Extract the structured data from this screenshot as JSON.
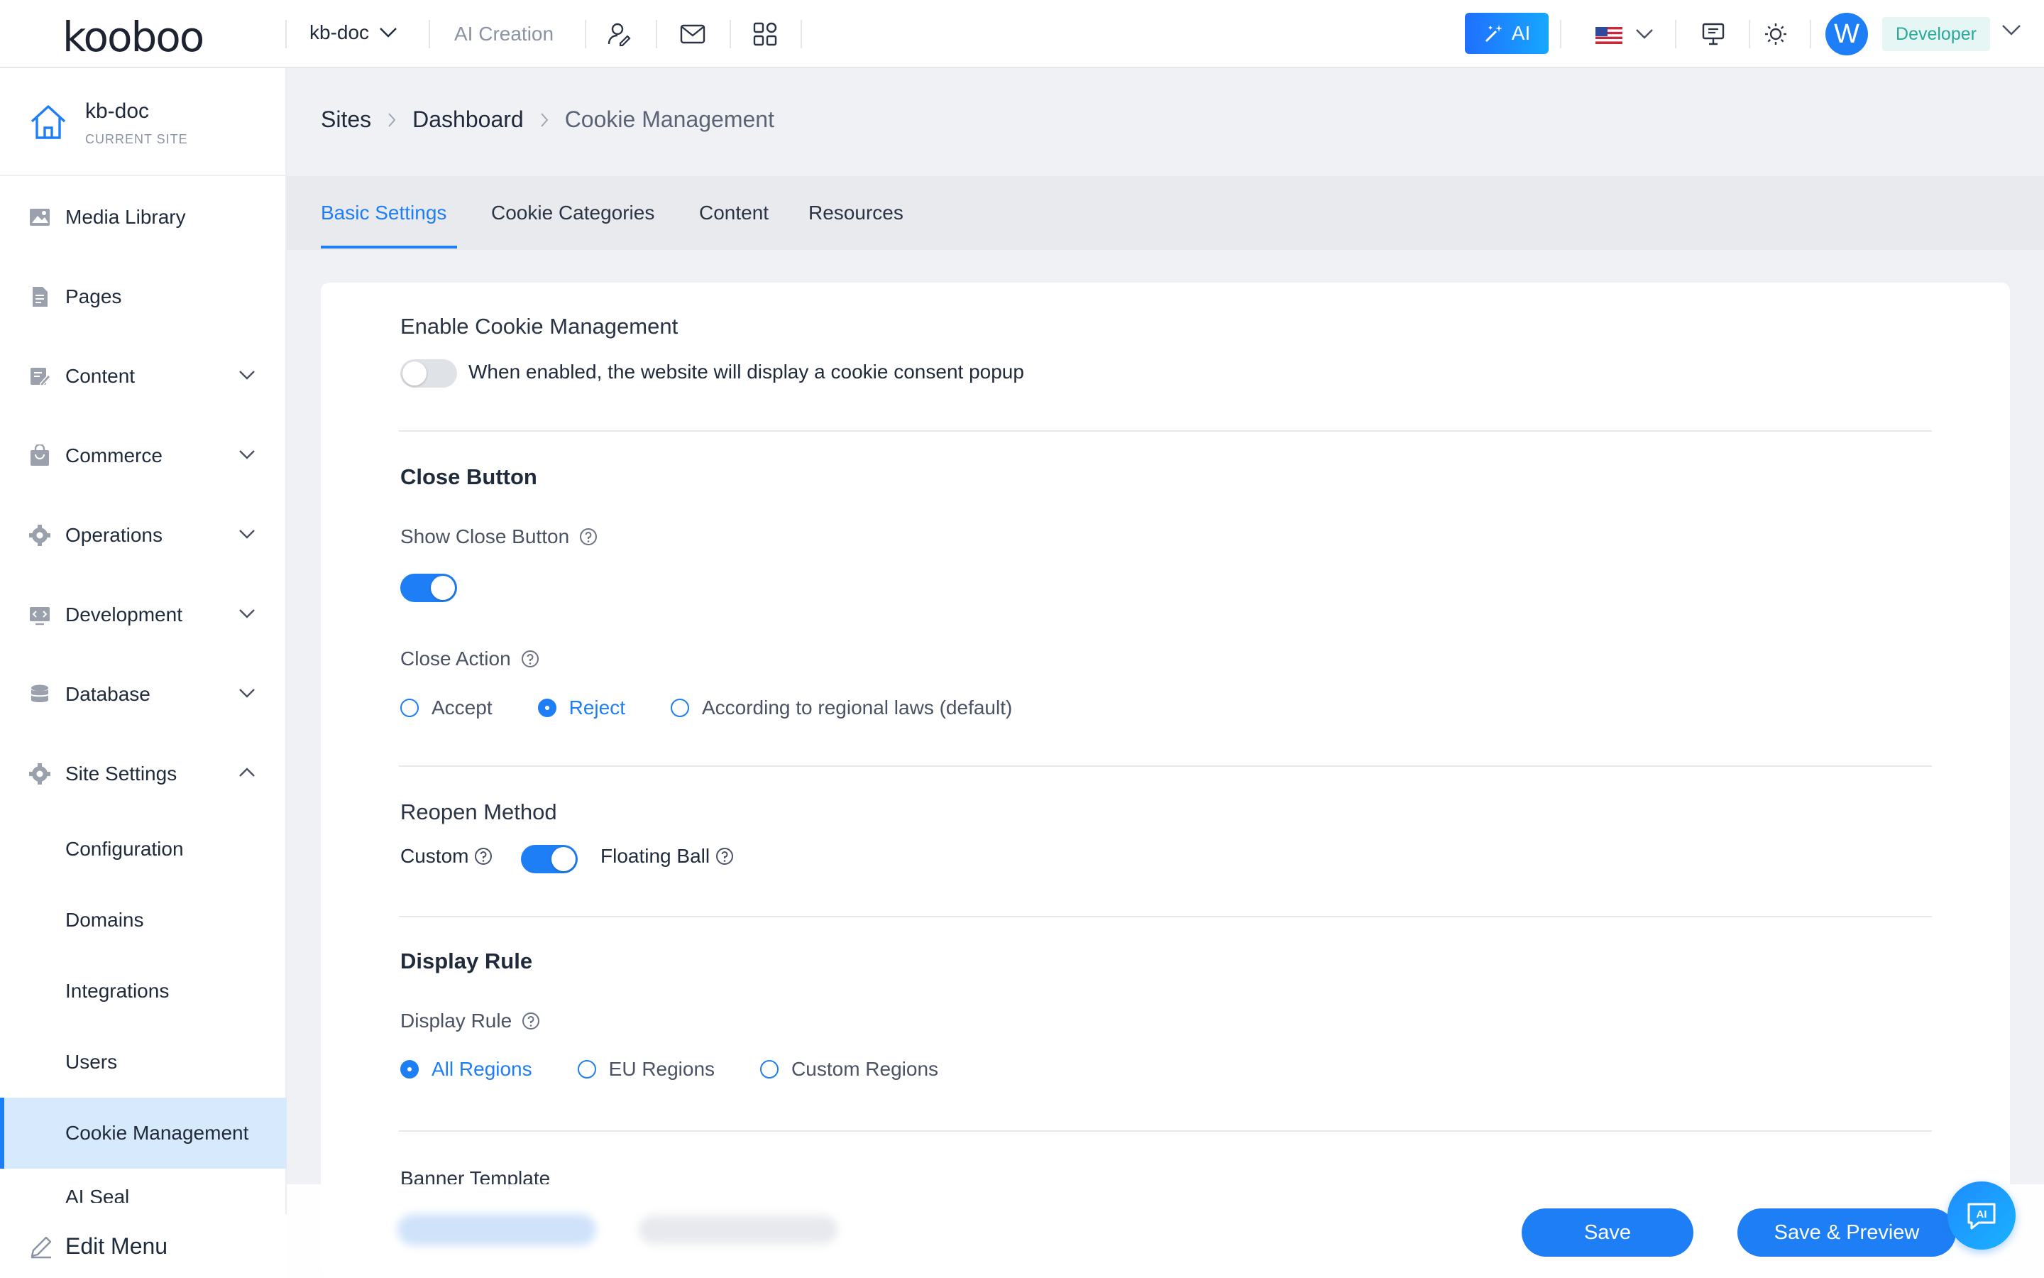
{
  "app": {
    "logo": "kooboo",
    "site_name": "kb-doc",
    "ai_creation": "AI Creation",
    "ai_button": "AI",
    "avatar_letter": "W",
    "role": "Developer",
    "brand_color": "#1e7ef5"
  },
  "sidebar": {
    "current_site_name": "kb-doc",
    "current_site_label": "CURRENT SITE",
    "items": [
      {
        "label": "Media Library",
        "icon": "image-icon"
      },
      {
        "label": "Pages",
        "icon": "document-icon"
      },
      {
        "label": "Content",
        "icon": "edit-doc-icon"
      },
      {
        "label": "Commerce",
        "icon": "bag-icon"
      },
      {
        "label": "Operations",
        "icon": "gear-icon"
      },
      {
        "label": "Development",
        "icon": "code-icon"
      },
      {
        "label": "Database",
        "icon": "database-icon"
      },
      {
        "label": "Site Settings",
        "icon": "gear-icon"
      }
    ],
    "sub_items": [
      "Configuration",
      "Domains",
      "Integrations",
      "Users",
      "Cookie Management",
      "AI Seal"
    ],
    "edit_menu": "Edit Menu"
  },
  "breadcrumb": [
    "Sites",
    "Dashboard",
    "Cookie Management"
  ],
  "tabs": [
    "Basic Settings",
    "Cookie Categories",
    "Content",
    "Resources"
  ],
  "form": {
    "enable": {
      "title": "Enable Cookie Management",
      "description": "When enabled, the website will display a cookie consent popup",
      "enabled": false
    },
    "close_button": {
      "title": "Close Button",
      "show_label": "Show Close Button",
      "show_enabled": true,
      "action_label": "Close Action",
      "options": [
        "Accept",
        "Reject",
        "According to regional laws (default)"
      ],
      "selected": "Reject"
    },
    "reopen": {
      "title": "Reopen Method",
      "left_label": "Custom",
      "right_label": "Floating Ball",
      "floating_ball": true
    },
    "display_rule": {
      "title": "Display Rule",
      "label": "Display Rule",
      "options": [
        "All Regions",
        "EU Regions",
        "Custom Regions"
      ],
      "selected": "All Regions"
    },
    "banner_template": {
      "title": "Banner Template"
    }
  },
  "footer": {
    "save": "Save",
    "save_preview": "Save & Preview",
    "fab_label": "AI"
  }
}
